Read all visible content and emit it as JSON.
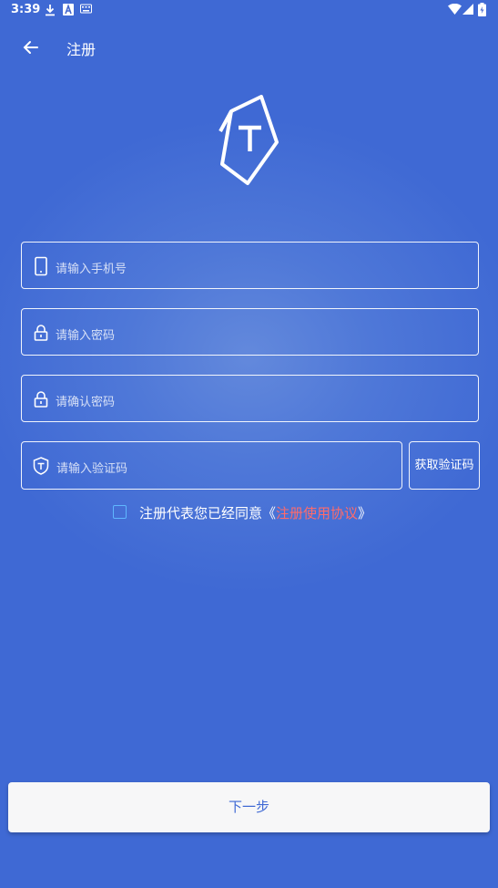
{
  "status_bar": {
    "time": "3:39",
    "left_icons": [
      "download-icon",
      "a-icon",
      "keyboard-icon"
    ],
    "right_icons": [
      "wifi-icon",
      "signal-icon",
      "battery-icon"
    ]
  },
  "app_bar": {
    "back_icon": "arrow-left-icon",
    "title": "注册"
  },
  "logo": {
    "icon": "shield-t-logo-icon"
  },
  "form": {
    "phone": {
      "placeholder": "请输入手机号",
      "icon": "phone-icon"
    },
    "password": {
      "placeholder": "请输入密码",
      "icon": "lock-icon"
    },
    "confirm_password": {
      "placeholder": "请确认密码",
      "icon": "lock-icon"
    },
    "verification_code": {
      "placeholder": "请输入验证码",
      "icon": "shield-icon"
    },
    "get_code_label": "获取验证码"
  },
  "agreement": {
    "checked": false,
    "text_prefix": "注册代表您已经同意《",
    "link_text": "注册使用协议",
    "text_suffix": "》"
  },
  "next_label": "下一步",
  "colors": {
    "background": "#4169d4",
    "link": "#ff6b6b",
    "checkbox_border": "#5fb7ff",
    "button_bg": "#f7f7f8",
    "button_text": "#3f69d4"
  }
}
